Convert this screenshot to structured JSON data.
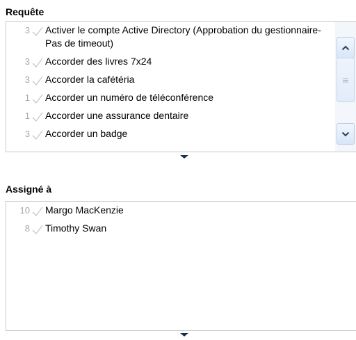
{
  "requests": {
    "title": "Requête",
    "items": [
      {
        "count": "3",
        "label": "Activer le compte Active Directory (Approbation du gestionnaire-Pas de timeout)"
      },
      {
        "count": "3",
        "label": "Accorder des livres 7x24"
      },
      {
        "count": "3",
        "label": "Accorder la cafétéria"
      },
      {
        "count": "1",
        "label": "Accorder un numéro de téléconférence"
      },
      {
        "count": "1",
        "label": "Accorder une assurance dentaire"
      },
      {
        "count": "3",
        "label": "Accorder un badge"
      }
    ]
  },
  "assigned": {
    "title": "Assigné à",
    "items": [
      {
        "count": "10",
        "label": "Margo MacKenzie"
      },
      {
        "count": "8",
        "label": "Timothy Swan"
      }
    ]
  },
  "colors": {
    "count_gray": "#a9a9a9",
    "check_gray": "#c8c8c8",
    "border_gray": "#c9c9c9",
    "scroll_blue": "#b7cbe4",
    "arrow_dark": "#1b2a4d"
  },
  "icons": {
    "check": "check-icon",
    "scroll_up": "chevron-up-icon",
    "scroll_down": "chevron-down-icon",
    "thumb": "scroll-grip-icon",
    "resize": "resize-triangle-icon"
  }
}
